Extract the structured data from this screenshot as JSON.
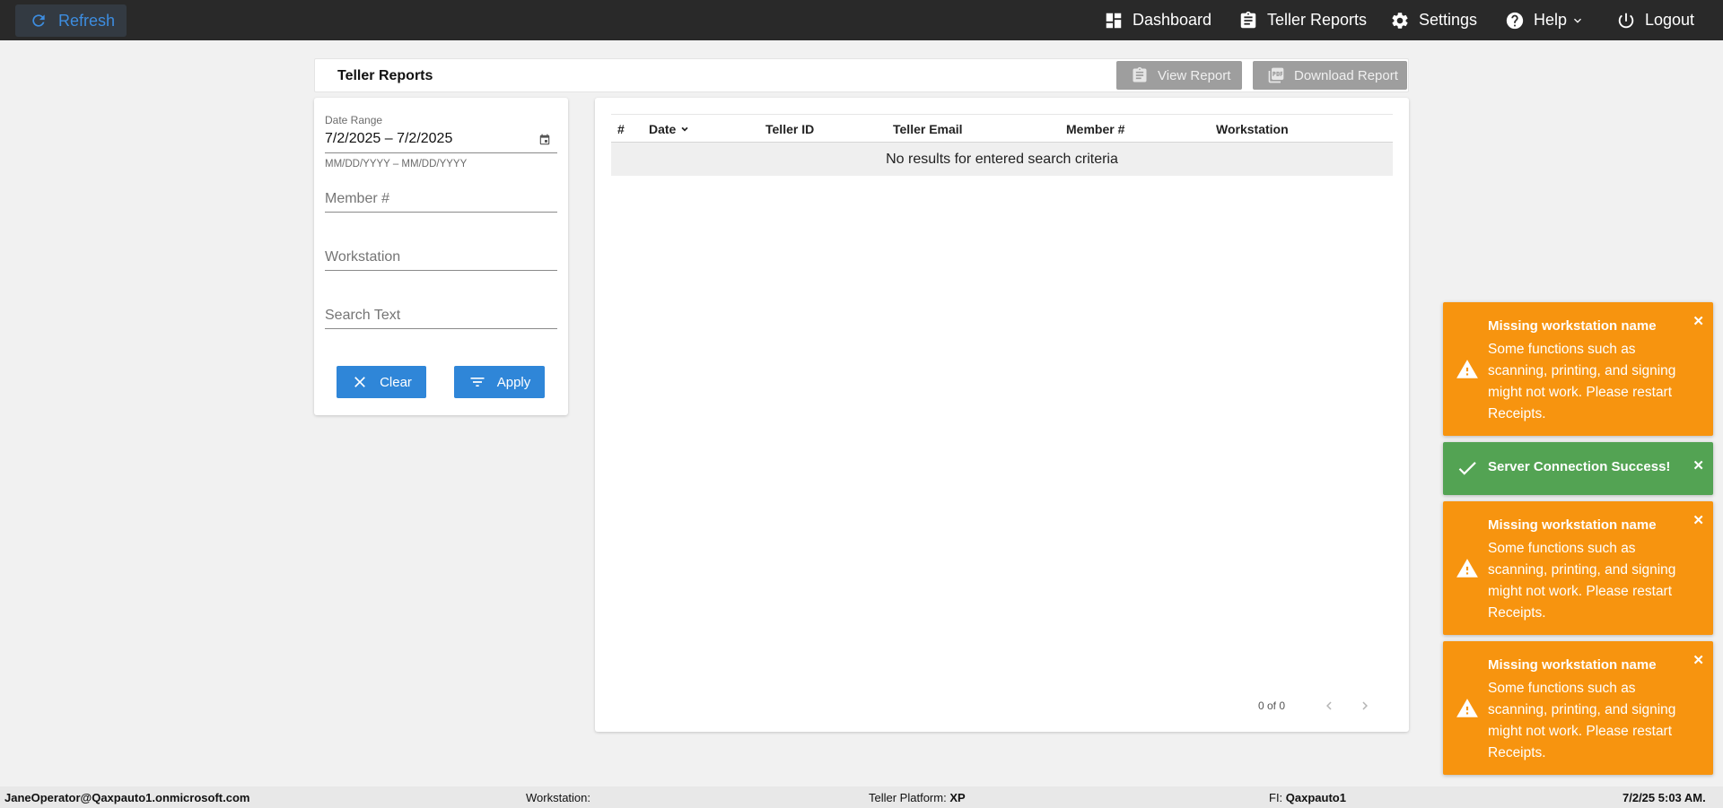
{
  "topbar": {
    "refresh_label": "Refresh",
    "nav": {
      "dashboard": "Dashboard",
      "teller_reports": "Teller Reports",
      "settings": "Settings",
      "help": "Help",
      "logout": "Logout"
    }
  },
  "header": {
    "title": "Teller Reports",
    "view_report": "View Report",
    "download_report": "Download Report"
  },
  "filters": {
    "date_range_label": "Date Range",
    "date_range_value": "7/2/2025 – 7/2/2025",
    "date_hint": "MM/DD/YYYY – MM/DD/YYYY",
    "member_placeholder": "Member #",
    "workstation_placeholder": "Workstation",
    "search_placeholder": "Search Text",
    "clear_label": "Clear",
    "apply_label": "Apply"
  },
  "table": {
    "columns": [
      "#",
      "Date",
      "Teller ID",
      "Teller Email",
      "Member #",
      "Workstation"
    ],
    "empty_message": "No results for entered search criteria",
    "pager_text": "0 of 0"
  },
  "toasts": [
    {
      "type": "warning",
      "title": "Missing workstation name",
      "body": "Some functions such as scanning, printing, and signing might not work. Please restart Receipts."
    },
    {
      "type": "success",
      "title": "Server Connection Success!",
      "body": ""
    },
    {
      "type": "warning",
      "title": "Missing workstation name",
      "body": "Some functions such as scanning, printing, and signing might not work. Please restart Receipts."
    },
    {
      "type": "warning",
      "title": "Missing workstation name",
      "body": "Some functions such as scanning, printing, and signing might not work. Please restart Receipts."
    }
  ],
  "footer": {
    "user": "JaneOperator@Qaxpauto1.onmicrosoft.com",
    "workstation_label": "Workstation:",
    "workstation_value": "",
    "platform_label": "Teller Platform:",
    "platform_value": "XP",
    "fi_label": "FI:",
    "fi_value": "Qaxpauto1",
    "datetime": "7/2/25 5:03 AM."
  },
  "colors": {
    "topbar": "#292929",
    "accent_blue": "#2f86d8",
    "warning": "#f7940f",
    "success": "#53a353",
    "disabled_button": "#9e9e9e"
  }
}
